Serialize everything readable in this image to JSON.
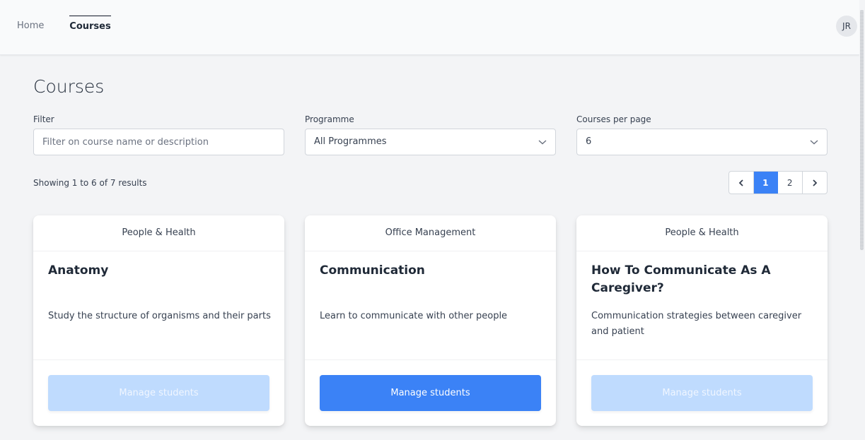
{
  "nav": {
    "items": [
      {
        "label": "Home",
        "active": false
      },
      {
        "label": "Courses",
        "active": true
      }
    ],
    "avatar_initials": "JR"
  },
  "page": {
    "title": "Courses"
  },
  "filters": {
    "filter": {
      "label": "Filter",
      "placeholder": "Filter on course name or description",
      "value": ""
    },
    "programme": {
      "label": "Programme",
      "selected": "All Programmes"
    },
    "per_page": {
      "label": "Courses per page",
      "selected": "6"
    }
  },
  "results": {
    "summary": "Showing 1 to 6 of 7 results"
  },
  "pagination": {
    "prev_icon": "chevron-left-icon",
    "pages": [
      "1",
      "2"
    ],
    "current_page": "1",
    "next_icon": "chevron-right-icon"
  },
  "courses": [
    {
      "programme": "People & Health",
      "title": "Anatomy",
      "description": "Study the structure of organisms and their parts",
      "button_label": "Manage students",
      "button_enabled": false
    },
    {
      "programme": "Office Management",
      "title": "Communication",
      "description": "Learn to communicate with other people",
      "button_label": "Manage students",
      "button_enabled": true
    },
    {
      "programme": "People & Health",
      "title": "How To Communicate As A Caregiver?",
      "description": "Communication strategies between caregiver and patient",
      "button_label": "Manage students",
      "button_enabled": false
    }
  ],
  "colors": {
    "accent": "#3b82f6",
    "accent_disabled": "#bfdbfe",
    "background": "#f3f4f6"
  }
}
